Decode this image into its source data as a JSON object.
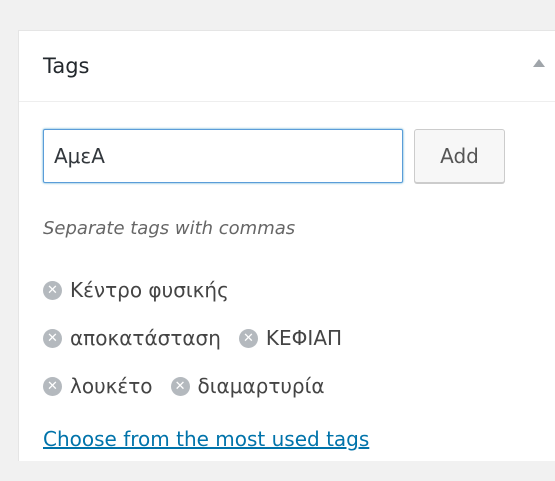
{
  "panel": {
    "title": "Tags",
    "toggle_icon": "triangle-up-icon"
  },
  "tag_input": {
    "value": "ΑμεΑ"
  },
  "add_button": {
    "label": "Add"
  },
  "howto": "Separate tags with commas",
  "tags": [
    {
      "label": "Κέντρο φυσικής",
      "remove_icon": "remove-circle-icon"
    },
    {
      "label": "αποκατάσταση",
      "remove_icon": "remove-circle-icon"
    },
    {
      "label": "ΚΕΦΙΑΠ",
      "remove_icon": "remove-circle-icon"
    },
    {
      "label": "λουκέτο",
      "remove_icon": "remove-circle-icon"
    },
    {
      "label": "διαμαρτυρία",
      "remove_icon": "remove-circle-icon"
    }
  ],
  "most_used_link": "Choose from the most used tags",
  "colors": {
    "link": "#0073aa",
    "input_focus_border": "#5b9dd9",
    "remove_icon": "#b4b9be"
  }
}
